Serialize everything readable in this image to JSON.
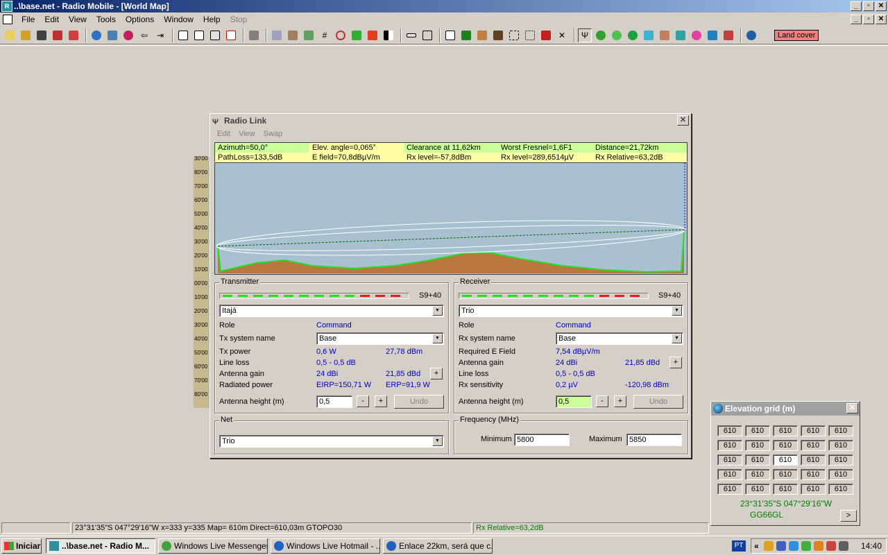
{
  "app": {
    "title": "..\\base.net - Radio Mobile - [World Map]",
    "menu": [
      "File",
      "Edit",
      "View",
      "Tools",
      "Options",
      "Window",
      "Help",
      "Stop"
    ],
    "land_cover": "Land cover"
  },
  "map": {
    "lat_labels": [
      "30'00",
      "80'00",
      "70'00",
      "60'00",
      "50'00",
      "40'00",
      "30'00",
      "20'00",
      "10'00",
      "00'00",
      "10'00",
      "20'00",
      "30'00",
      "40'00",
      "50'00",
      "60'00",
      "70'00",
      "80'00"
    ]
  },
  "radio_link": {
    "title": "Radio Link",
    "menu": [
      "Edit",
      "View",
      "Swap"
    ],
    "info": {
      "azimuth": "Azimuth=50,0°",
      "elev_angle": "Elev. angle=0,065°",
      "clearance": "Clearance at 11,62km",
      "worst_fresnel": "Worst Fresnel=1,6F1",
      "distance": "Distance=21,72km",
      "path_loss": "PathLoss=133,5dB",
      "e_field": "E field=70,8dBµV/m",
      "rx_level_dbm": "Rx level=-57,8dBm",
      "rx_level_uv": "Rx level=289,6514µV",
      "rx_relative": "Rx Relative=63,2dB"
    },
    "transmitter": {
      "group_label": "Transmitter",
      "s_meter": "S9+40",
      "unit": "Itajá",
      "role_label": "Role",
      "role_value": "Command",
      "system_label": "Tx system name",
      "system_value": "Base",
      "power_label": "Tx power",
      "power_w": "0,6 W",
      "power_dbm": "27,78 dBm",
      "line_loss_label": "Line loss",
      "line_loss_value": "0,5 - 0,5 dB",
      "gain_label": "Antenna gain",
      "gain_dbi": "24 dBi",
      "gain_dbd": "21,85 dBd",
      "radiated_label": "Radiated power",
      "eirp": "EIRP=150,71 W",
      "erp": "ERP=91,9 W",
      "height_label": "Antenna height (m)",
      "height_value": "0,5",
      "minus": "-",
      "plus": "+",
      "undo": "Undo"
    },
    "receiver": {
      "group_label": "Receiver",
      "s_meter": "S9+40",
      "unit": "Trio",
      "role_label": "Role",
      "role_value": "Command",
      "system_label": "Rx system name",
      "system_value": "Base",
      "field_label": "Required E Field",
      "field_value": "7,54 dBµV/m",
      "gain_label": "Antenna gain",
      "gain_dbi": "24 dBi",
      "gain_dbd": "21,85 dBd",
      "line_loss_label": "Line loss",
      "line_loss_value": "0,5 - 0,5 dB",
      "sens_label": "Rx sensitivity",
      "sens_uv": "0,2 µV",
      "sens_dbm": "-120,98 dBm",
      "height_label": "Antenna height (m)",
      "height_value": "0,5",
      "minus": "-",
      "plus": "+",
      "undo": "Undo"
    },
    "net": {
      "group_label": "Net",
      "value": "Trio"
    },
    "frequency": {
      "group_label": "Frequency (MHz)",
      "min_label": "Minimum",
      "min_value": "5800",
      "max_label": "Maximum",
      "max_value": "5850"
    }
  },
  "elevation_grid": {
    "title": "Elevation grid (m)",
    "rows": [
      [
        "610",
        "610",
        "610",
        "610",
        "610"
      ],
      [
        "610",
        "610",
        "610",
        "610",
        "610"
      ],
      [
        "610",
        "610",
        "610",
        "610",
        "610"
      ],
      [
        "610",
        "610",
        "610",
        "610",
        "610"
      ],
      [
        "610",
        "610",
        "610",
        "610",
        "610"
      ]
    ],
    "coords": "23°31'35\"S  047°29'16\"W",
    "locator": "GG66GL",
    "next": ">"
  },
  "status_bar": {
    "position": "23°31'35\"S  047°29'16\"W  x=333 y=335 Map= 610m Direct=610,03m GTOPO30",
    "rx_relative": "Rx Relative=63,2dB"
  },
  "taskbar": {
    "start": "Iniciar",
    "tasks": [
      "..\\base.net - Radio M...",
      "Windows Live Messenger",
      "Windows Live Hotmail - ...",
      "Enlace 22km, será que c..."
    ],
    "lang": "PT",
    "tray_arrow": "«",
    "clock": "14:40"
  },
  "colors": {
    "title_bar": "#0a246a",
    "info_green": "#ccff99",
    "info_yellow": "#ffffa8",
    "sky": "#a8c0d0",
    "terrain": "#b87840",
    "terrain_line": "#20e020",
    "meter_green": "#20e020",
    "meter_red": "#e02020",
    "value_blue": "#0000c0"
  }
}
